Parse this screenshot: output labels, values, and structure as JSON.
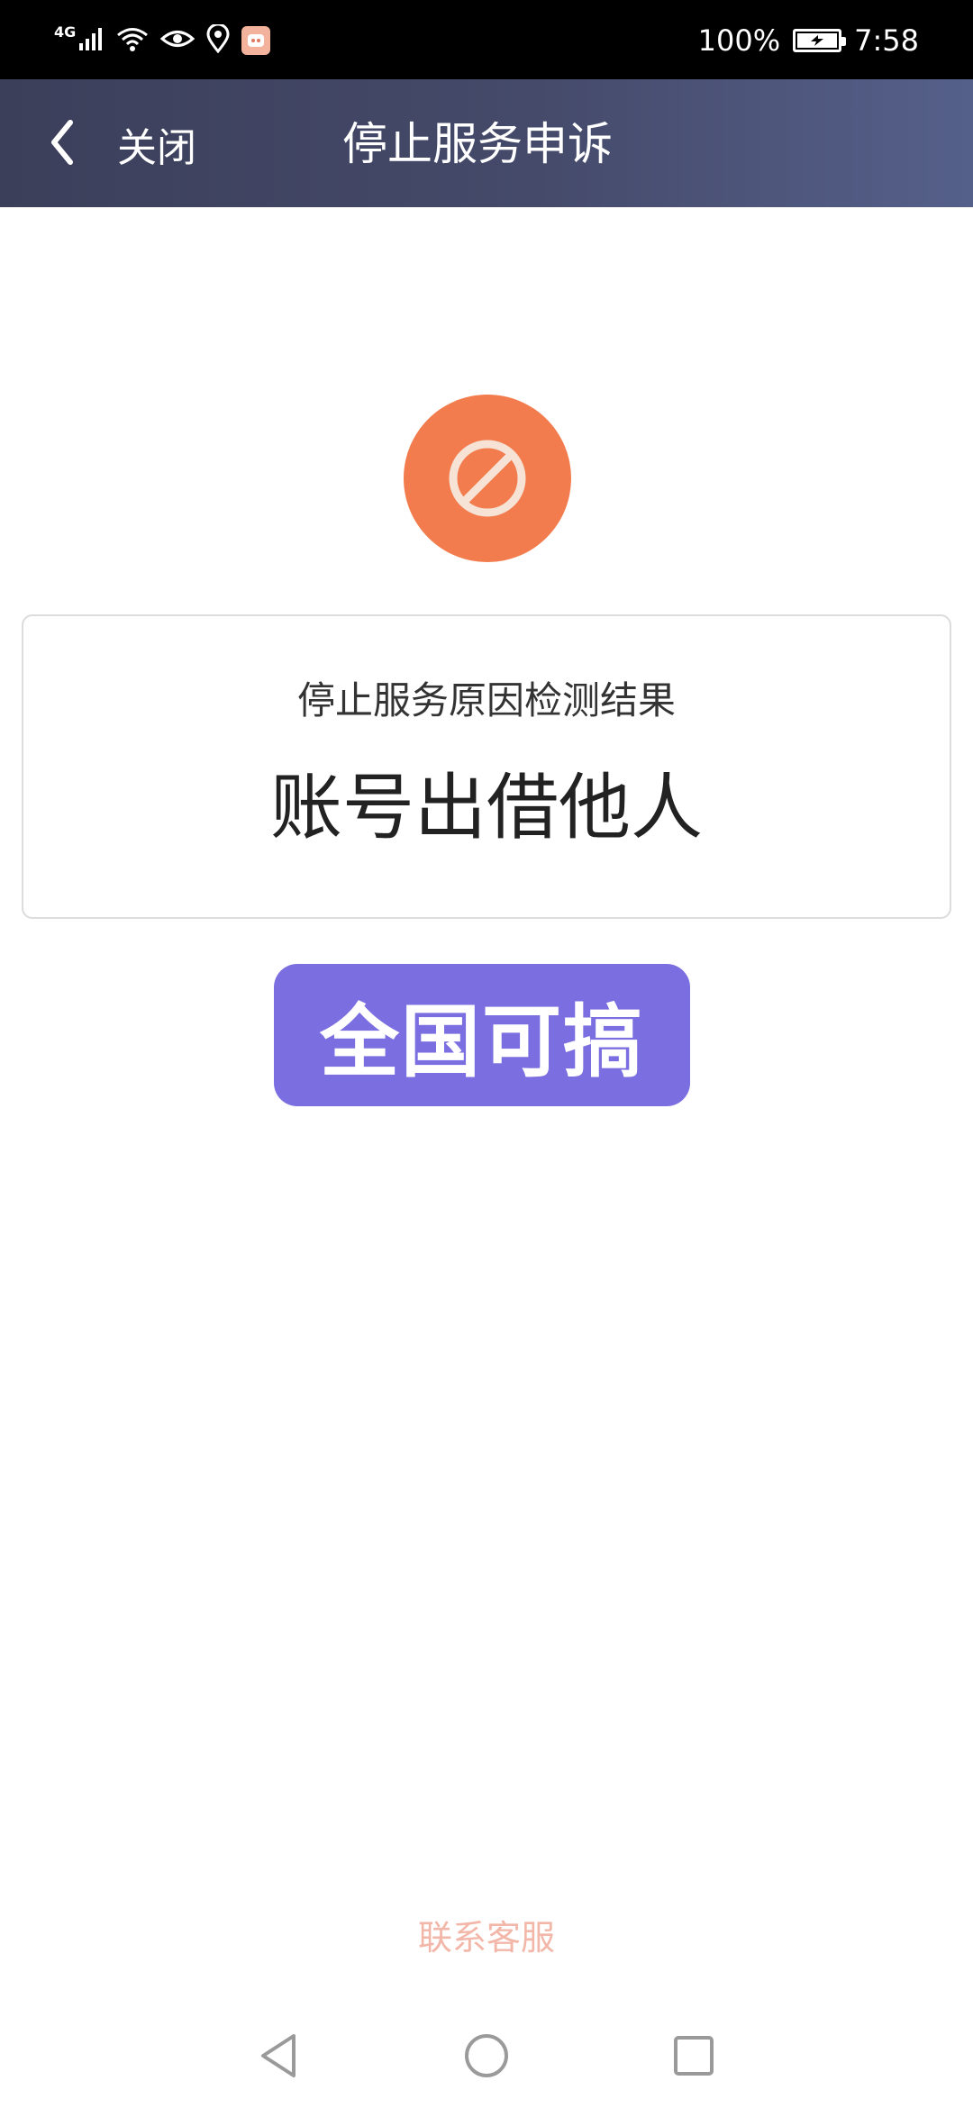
{
  "status_bar": {
    "network": "4G",
    "battery_percent": "100%",
    "time": "7:58"
  },
  "header": {
    "back_label": "关闭",
    "title": "停止服务申诉"
  },
  "result_card": {
    "caption": "停止服务原因检测结果",
    "value": "账号出借他人"
  },
  "stamp": {
    "text": "全国可搞"
  },
  "footer": {
    "contact_label": "联系客服"
  },
  "icons": {
    "status": [
      "signal-icon",
      "wifi-icon",
      "eye-icon",
      "location-icon",
      "app-badge-icon",
      "battery-icon"
    ],
    "header": [
      "chevron-left-icon"
    ],
    "main": [
      "prohibited-icon"
    ],
    "system_nav": [
      "back-triangle-icon",
      "home-circle-icon",
      "recents-square-icon"
    ]
  },
  "colors": {
    "header_bg": "#454a6a",
    "prohibit_icon": "#f27c4d",
    "stamp_bg": "#7b6ee0",
    "contact_link": "#f2b7a8"
  }
}
